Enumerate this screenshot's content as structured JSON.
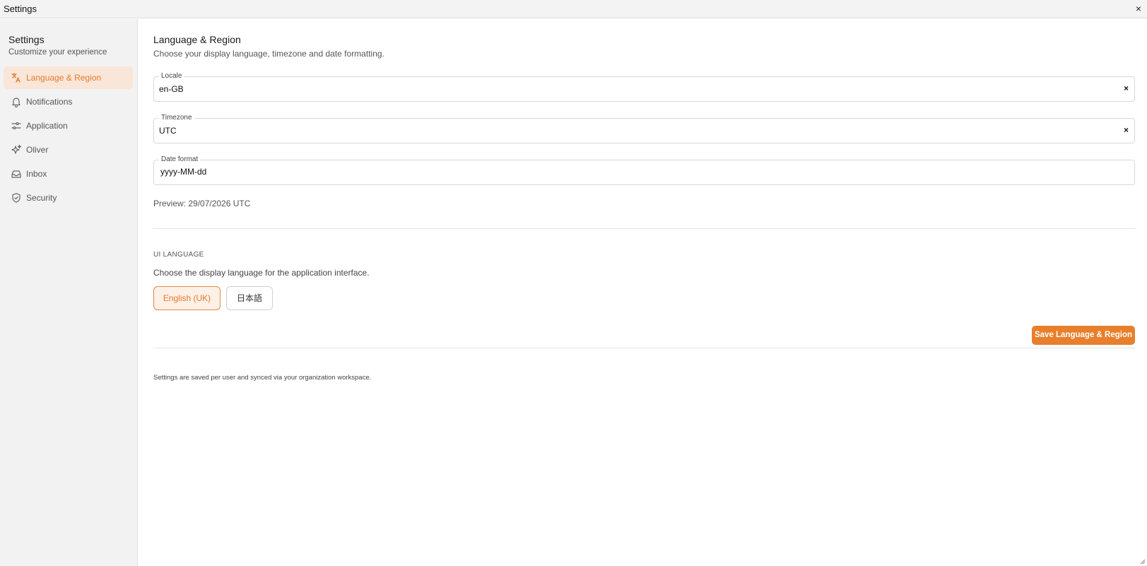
{
  "window": {
    "title": "Settings",
    "close_glyph": "×"
  },
  "sidebar": {
    "title": "Settings",
    "subtitle": "Customize your experience",
    "items": [
      {
        "label": "Language & Region",
        "icon": "translate-icon",
        "active": true
      },
      {
        "label": "Notifications",
        "icon": "bell-icon",
        "active": false
      },
      {
        "label": "Application",
        "icon": "sliders-icon",
        "active": false
      },
      {
        "label": "Oliver",
        "icon": "sparkles-icon",
        "active": false
      },
      {
        "label": "Inbox",
        "icon": "inbox-icon",
        "active": false
      },
      {
        "label": "Security",
        "icon": "shield-icon",
        "active": false
      }
    ]
  },
  "main": {
    "title": "Language & Region",
    "subtitle": "Choose your display language, timezone and date formatting.",
    "locale": {
      "label": "Locale",
      "value": "en-GB",
      "clear_glyph": "×"
    },
    "timezone": {
      "label": "Timezone",
      "value": "UTC",
      "clear_glyph": "×"
    },
    "date_format": {
      "label": "Date format",
      "value": "yyyy-MM-dd"
    },
    "preview": "Preview: 29/07/2026 UTC",
    "ui_language": {
      "heading": "UI LANGUAGE",
      "description": "Choose the display language for the application interface.",
      "options": [
        {
          "label": "English (UK)",
          "selected": true
        },
        {
          "label": "日本語",
          "selected": false
        }
      ]
    },
    "save_label": "Save Language & Region",
    "footnote": "Settings are saved per user and synced via your organization workspace."
  },
  "colors": {
    "accent": "#e87f2c",
    "accent_bg": "#fae6d8",
    "sidebar_bg": "#f2f2f2"
  }
}
